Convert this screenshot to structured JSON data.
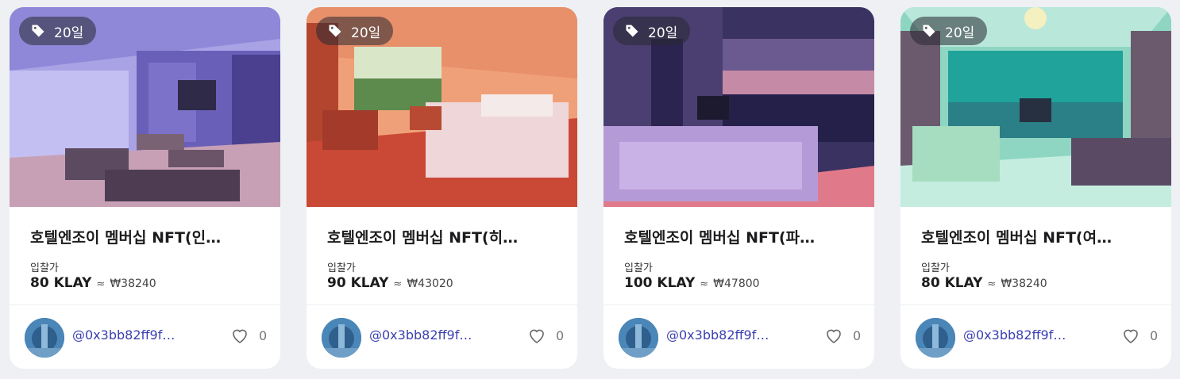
{
  "cards": [
    {
      "tag_icon": "price-tag-icon",
      "days": "20일",
      "title": "호텔엔조이 멤버십 NFT(인…",
      "bid_label": "입찰가",
      "price": "80 KLAY",
      "approx": "≈",
      "krw": "₩38240",
      "owner": "@0x3bb82ff9f…",
      "likes": "0",
      "theme": "lavender"
    },
    {
      "tag_icon": "price-tag-icon",
      "days": "20일",
      "title": "호텔엔조이 멤버십 NFT(히…",
      "bid_label": "입찰가",
      "price": "90 KLAY",
      "approx": "≈",
      "krw": "₩43020",
      "owner": "@0x3bb82ff9f…",
      "likes": "0",
      "theme": "coral"
    },
    {
      "tag_icon": "price-tag-icon",
      "days": "20일",
      "title": "호텔엔조이 멤버십 NFT(파…",
      "bid_label": "입찰가",
      "price": "100 KLAY",
      "approx": "≈",
      "krw": "₩47800",
      "owner": "@0x3bb82ff9f…",
      "likes": "0",
      "theme": "night"
    },
    {
      "tag_icon": "price-tag-icon",
      "days": "20일",
      "title": "호텔엔조이 멤버십 NFT(여…",
      "bid_label": "입찰가",
      "price": "80 KLAY",
      "approx": "≈",
      "krw": "₩38240",
      "owner": "@0x3bb82ff9f…",
      "likes": "0",
      "theme": "teal"
    }
  ],
  "colors": {
    "owner_link": "#3a3fb0",
    "page_bg": "#eef0f4"
  }
}
